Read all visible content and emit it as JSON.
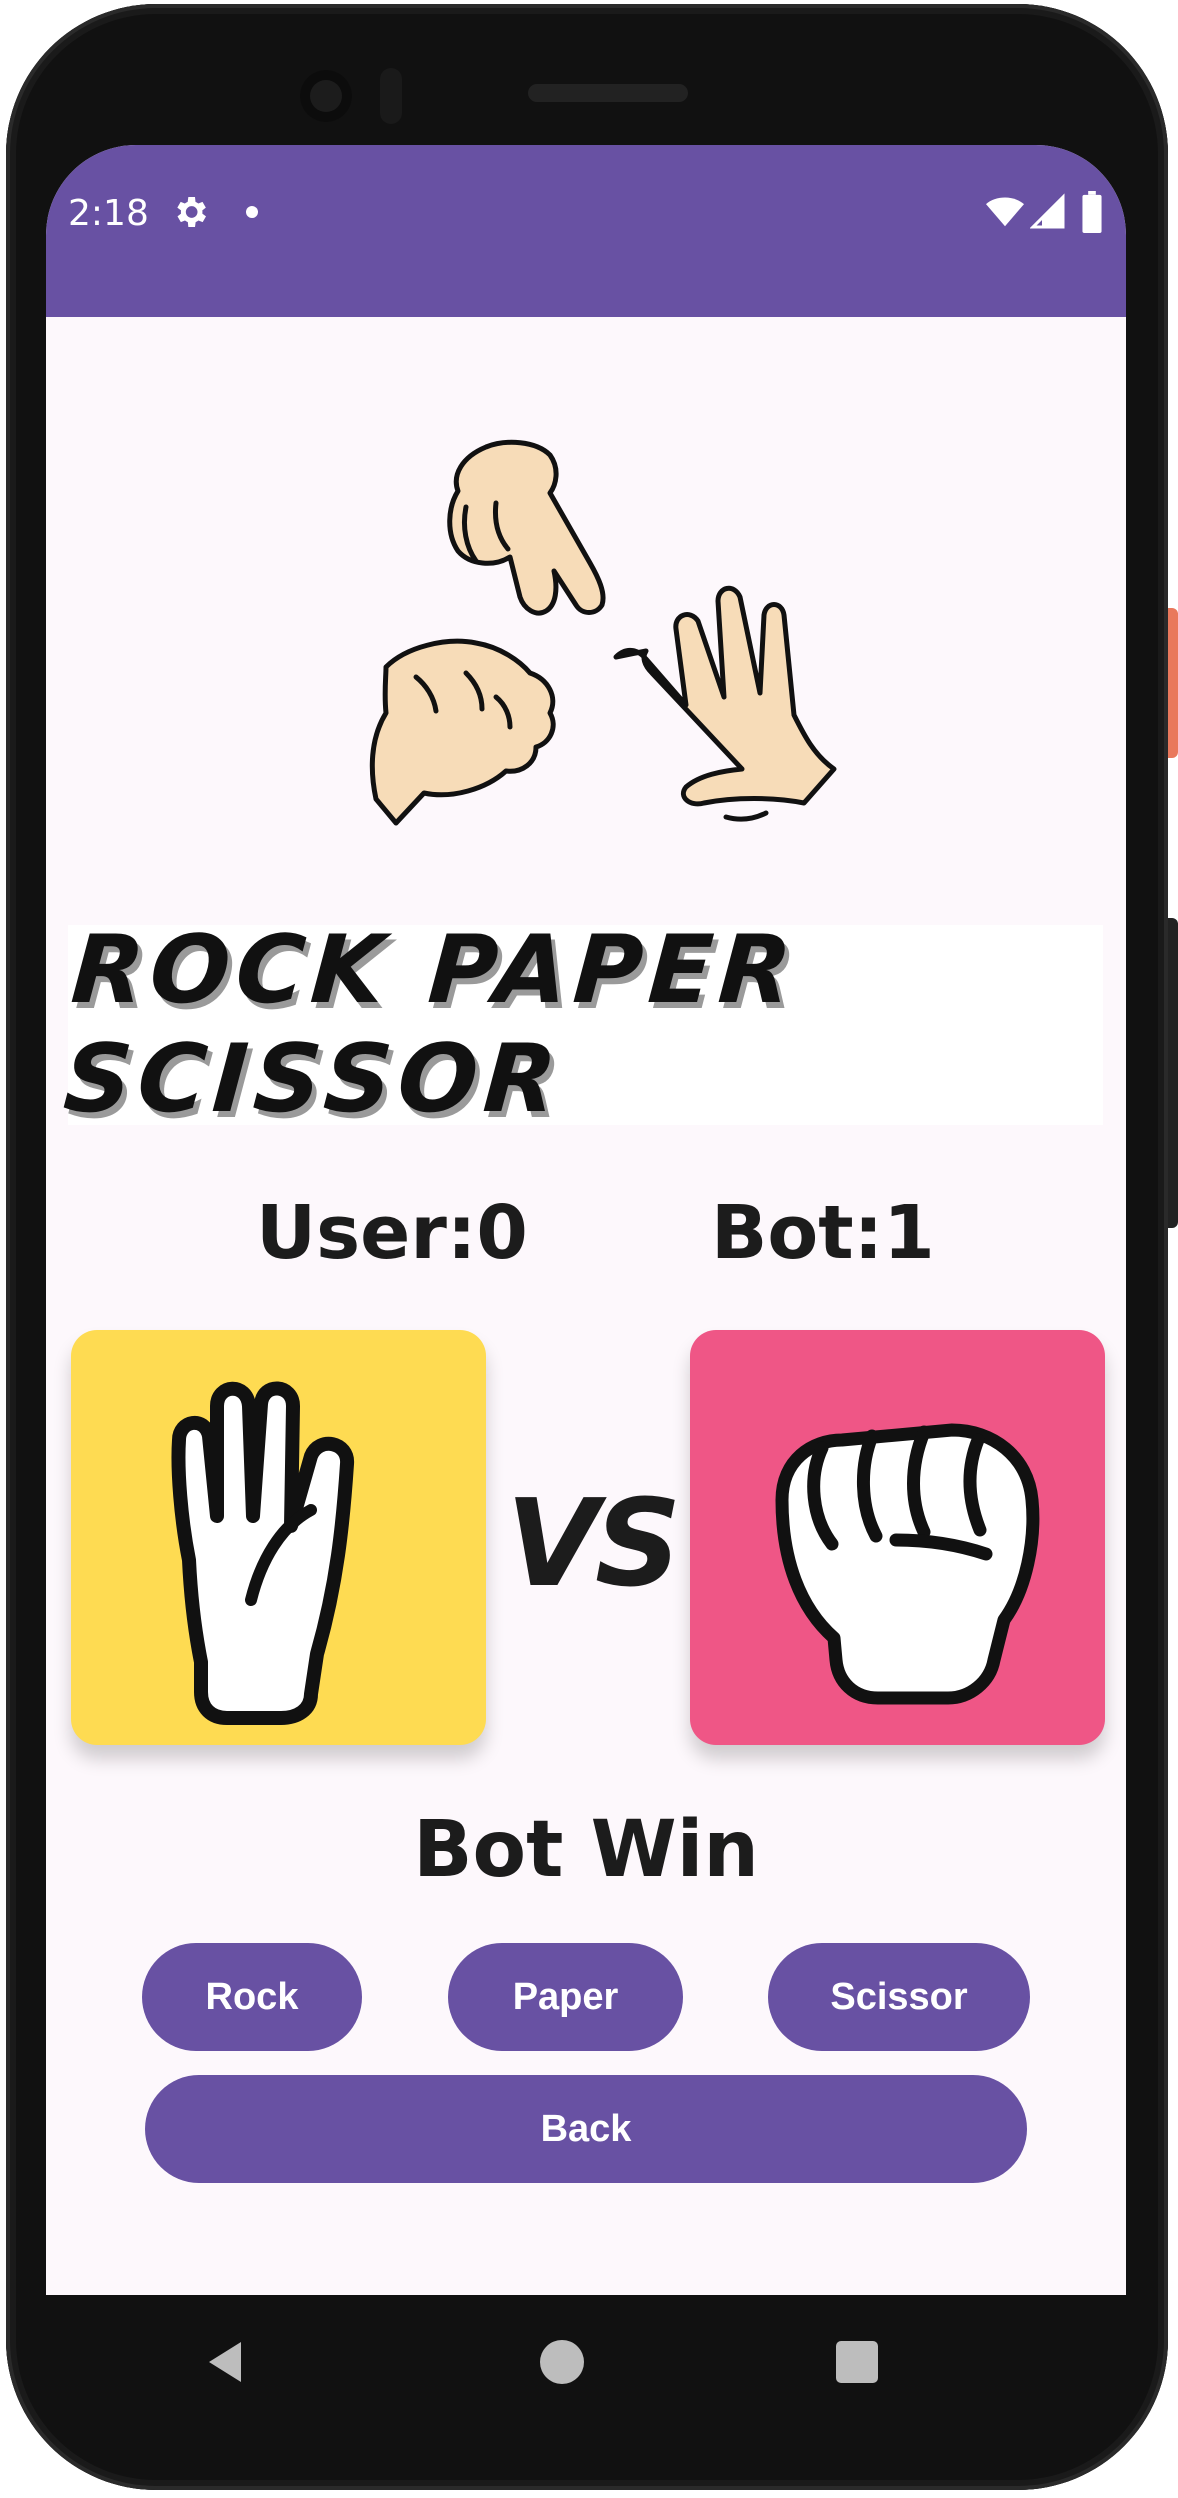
{
  "status_bar": {
    "time": "2:18",
    "settings_icon": "gear-icon",
    "notification_dot_icon": "dot-icon",
    "wifi_icon": "wifi-icon",
    "signal_icon": "signal-icon",
    "battery_icon": "battery-icon",
    "background_color": "#6851a3"
  },
  "game": {
    "logo_icon": "rock-paper-scissors-hands-icon",
    "title": "ROCK PAPER SCISSOR",
    "user_score": "User:0",
    "bot_score": "Bot:1",
    "user_choice_icon": "paper-hand-icon",
    "bot_choice_icon": "rock-fist-icon",
    "vs_label": "VS",
    "result": "Bot Win",
    "user_card_color": "#fedb52",
    "bot_card_color": "#ef5686"
  },
  "buttons": {
    "rock": "Rock",
    "paper": "Paper",
    "scissor": "Scissor",
    "back": "Back",
    "color": "#6851a3"
  },
  "nav_bar": {
    "back_icon": "triangle-back-icon",
    "home_icon": "circle-home-icon",
    "recents_icon": "square-recents-icon"
  }
}
